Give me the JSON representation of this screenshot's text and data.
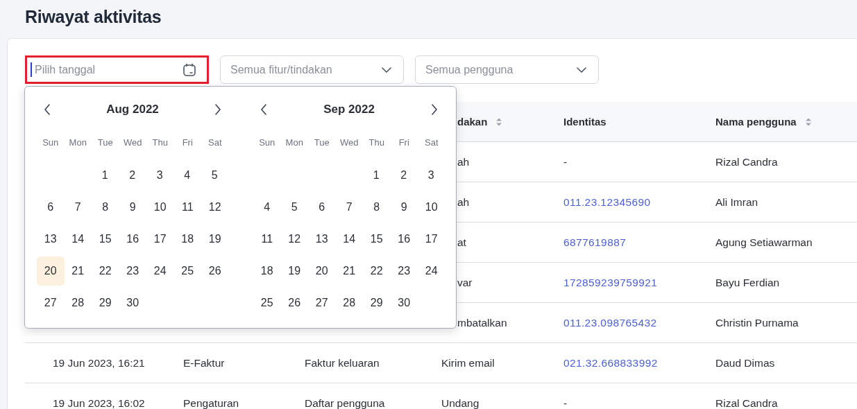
{
  "page_title": "Riwayat aktivitas",
  "filters": {
    "date": {
      "placeholder": "Pilih tanggal",
      "highlighted": true
    },
    "dropdowns": [
      {
        "placeholder": "Semua fitur/tindakan"
      },
      {
        "placeholder": "Semua pengguna"
      }
    ]
  },
  "calendar": {
    "months": [
      {
        "title": "Aug 2022",
        "weekdays": [
          "Sun",
          "Mon",
          "Tue",
          "Wed",
          "Thu",
          "Fri",
          "Sat"
        ],
        "weeks": [
          [
            {
              "day": "1",
              "selected": false
            },
            {
              "day": "2",
              "selected": false
            },
            {
              "day": "3",
              "selected": false
            },
            {
              "day": "4",
              "selected": false
            },
            {
              "day": "5",
              "selected": false
            }
          ],
          [
            {
              "day": "6",
              "selected": false
            },
            {
              "day": "7",
              "selected": false
            },
            {
              "day": "8",
              "selected": false
            },
            {
              "day": "9",
              "selected": false
            },
            {
              "day": "10",
              "selected": false
            },
            {
              "day": "11",
              "selected": false
            },
            {
              "day": "12",
              "selected": false
            }
          ],
          [
            {
              "day": "13",
              "selected": false
            },
            {
              "day": "14",
              "selected": false
            },
            {
              "day": "15",
              "selected": false
            },
            {
              "day": "16",
              "selected": false
            },
            {
              "day": "17",
              "selected": false
            },
            {
              "day": "18",
              "selected": false
            },
            {
              "day": "19",
              "selected": false
            }
          ],
          [
            {
              "day": "20",
              "selected": true
            },
            {
              "day": "21",
              "selected": false
            },
            {
              "day": "22",
              "selected": false
            },
            {
              "day": "23",
              "selected": false
            },
            {
              "day": "24",
              "selected": false
            },
            {
              "day": "25",
              "selected": false
            },
            {
              "day": "26",
              "selected": false
            }
          ],
          [
            {
              "day": "27",
              "selected": false
            },
            {
              "day": "28",
              "selected": false
            },
            {
              "day": "29",
              "selected": false
            },
            {
              "day": "30",
              "selected": false
            }
          ]
        ]
      },
      {
        "title": "Sep 2022",
        "weekdays": [
          "Sun",
          "Mon",
          "Tue",
          "Wed",
          "Thu",
          "Fri",
          "Sat"
        ],
        "weeks": [
          [
            {
              "day": "1",
              "selected": false
            },
            {
              "day": "2",
              "selected": false
            },
            {
              "day": "3",
              "selected": false
            }
          ],
          [
            {
              "day": "4",
              "selected": false
            },
            {
              "day": "5",
              "selected": false
            },
            {
              "day": "6",
              "selected": false
            },
            {
              "day": "7",
              "selected": false
            },
            {
              "day": "8",
              "selected": false
            },
            {
              "day": "9",
              "selected": false
            },
            {
              "day": "10",
              "selected": false
            }
          ],
          [
            {
              "day": "11",
              "selected": false
            },
            {
              "day": "12",
              "selected": false
            },
            {
              "day": "13",
              "selected": false
            },
            {
              "day": "14",
              "selected": false
            },
            {
              "day": "15",
              "selected": false
            },
            {
              "day": "16",
              "selected": false
            },
            {
              "day": "17",
              "selected": false
            }
          ],
          [
            {
              "day": "18",
              "selected": false
            },
            {
              "day": "19",
              "selected": false
            },
            {
              "day": "20",
              "selected": false
            },
            {
              "day": "21",
              "selected": false
            },
            {
              "day": "22",
              "selected": false
            },
            {
              "day": "23",
              "selected": false
            },
            {
              "day": "24",
              "selected": false
            }
          ],
          [
            {
              "day": "25",
              "selected": false
            },
            {
              "day": "26",
              "selected": false
            },
            {
              "day": "27",
              "selected": false
            },
            {
              "day": "28",
              "selected": false
            },
            {
              "day": "29",
              "selected": false
            },
            {
              "day": "30",
              "selected": false
            }
          ]
        ]
      }
    ]
  },
  "table": {
    "columns": [
      {
        "label": "dakan",
        "sortable": true
      },
      {
        "label": "Identitas",
        "sortable": false
      },
      {
        "label": "Nama pengguna",
        "sortable": true
      }
    ],
    "rows": [
      {
        "action": "ah",
        "identity": "-",
        "user": "Rizal Candra"
      },
      {
        "action": "ah",
        "identity": "011.23.12345690",
        "user": "Ali Imran"
      },
      {
        "action": "at",
        "identity": "6877619887",
        "user": "Agung Setiawarman"
      },
      {
        "action": "var",
        "identity": "172859239759921",
        "user": "Bayu Ferdian"
      },
      {
        "action": "mbatalkan",
        "identity": "011.23.098765432",
        "user": "Christin Purnama"
      },
      {
        "date": "19 Jun 2023, 16:21",
        "feature": "E-Faktur",
        "page": "Faktur keluaran",
        "action": "Kirim email",
        "identity": "021.32.668833992",
        "user": "Daud Dimas"
      },
      {
        "date": "19 Jun 2023, 16:02",
        "feature": "Pengaturan",
        "page": "Daftar pengguna",
        "action": "Undang",
        "identity": "-",
        "user": "Rizal Candra"
      }
    ]
  }
}
